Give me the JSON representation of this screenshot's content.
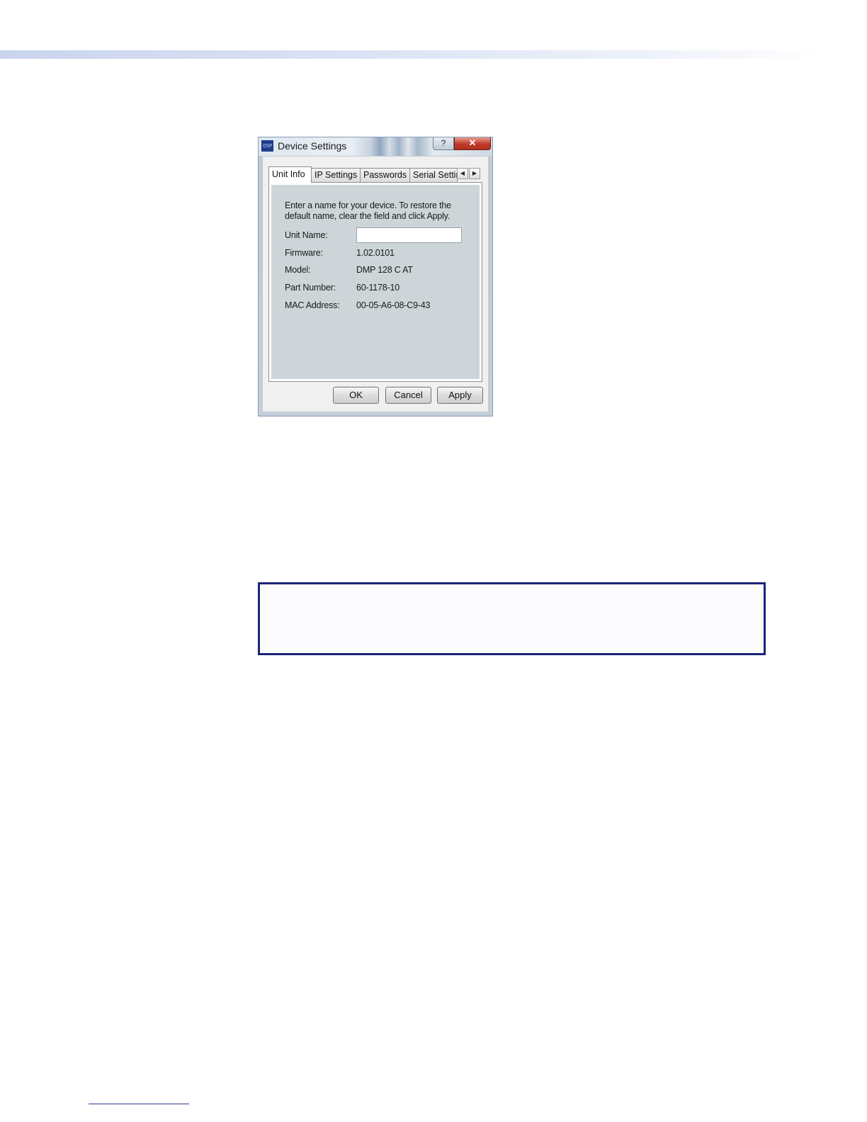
{
  "dialog": {
    "app_icon_text": "DSP",
    "title": "Device Settings",
    "help_glyph": "?",
    "close_glyph": "✕",
    "tabs": [
      {
        "label": "Unit Info",
        "active": true
      },
      {
        "label": "IP Settings",
        "active": false
      },
      {
        "label": "Passwords",
        "active": false
      },
      {
        "label": "Serial Settings",
        "active": false
      }
    ],
    "tab_scroll_left": "◀",
    "tab_scroll_right": "▶",
    "instructions": "Enter a name for your device.  To restore the default name, clear the field and click Apply.",
    "unit_name": {
      "label": "Unit Name:",
      "value": ""
    },
    "fields": [
      {
        "label": "Firmware:",
        "value": "1.02.0101"
      },
      {
        "label": "Model:",
        "value": "DMP 128 C AT"
      },
      {
        "label": "Part Number:",
        "value": "60-1178-10"
      },
      {
        "label": "MAC Address:",
        "value": "00-05-A6-08-C9-43"
      }
    ],
    "buttons": {
      "ok": "OK",
      "cancel": "Cancel",
      "apply": "Apply"
    }
  },
  "colors": {
    "note_border": "#1b2478",
    "close_button": "#c0392b",
    "panel_background": "#cdd5d8"
  }
}
